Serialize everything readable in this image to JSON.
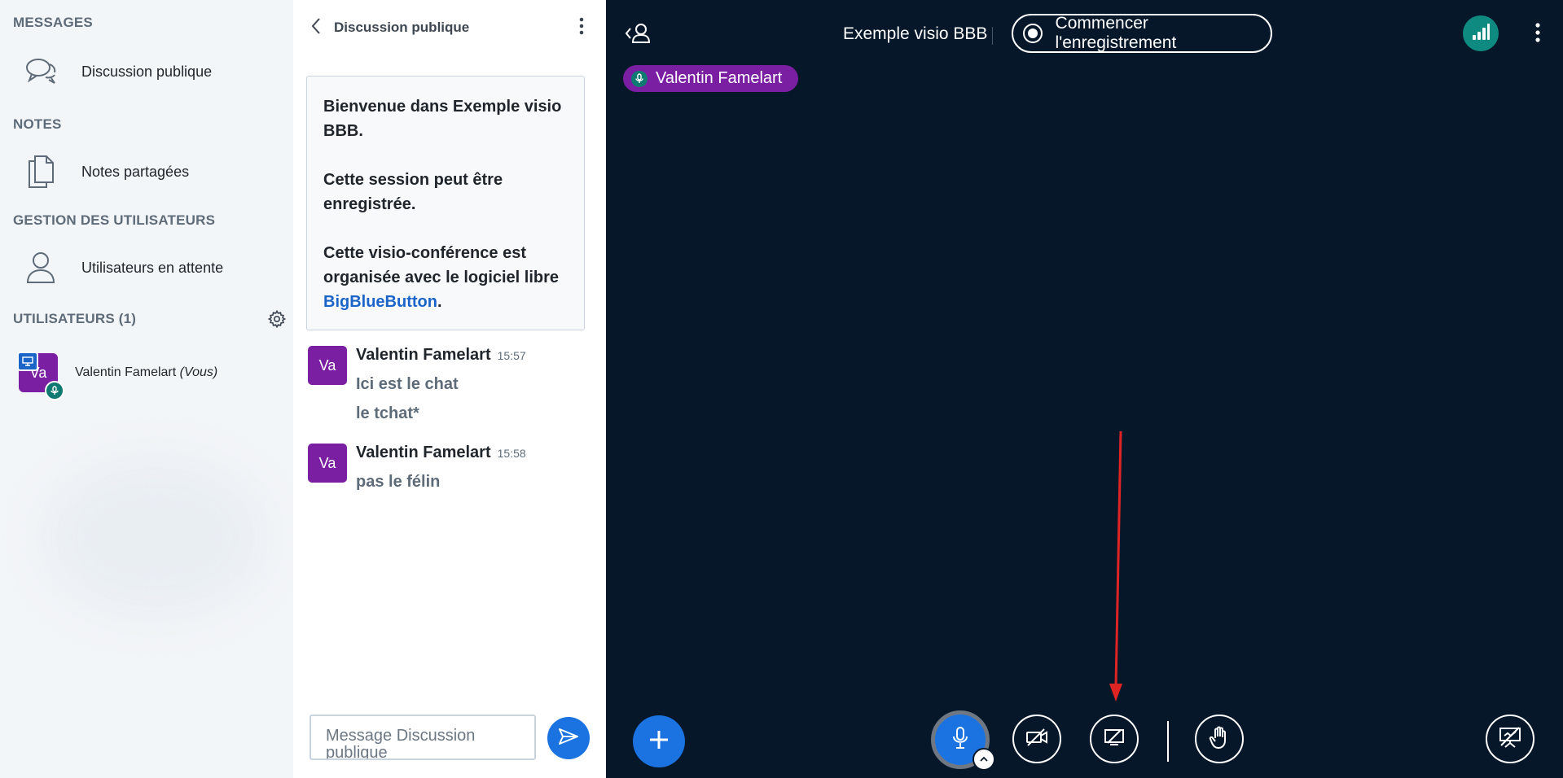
{
  "sidebar": {
    "messages_title": "MESSAGES",
    "public_chat_label": "Discussion publique",
    "notes_title": "NOTES",
    "shared_notes_label": "Notes partagées",
    "user_mgmt_title": "GESTION DES UTILISATEURS",
    "waiting_users_label": "Utilisateurs en attente",
    "users_title": "UTILISATEURS (1)",
    "user": {
      "initials": "Va",
      "name": "Valentin Famelart",
      "you_label": "(Vous)"
    }
  },
  "chat": {
    "title": "Discussion publique",
    "welcome": {
      "line1": "Bienvenue dans Exemple visio BBB.",
      "line2": "Cette session peut être enregistrée.",
      "line3_prefix": "Cette visio-conférence est organisée avec le logiciel libre ",
      "link": "BigBlueButton",
      "line3_suffix": "."
    },
    "messages": [
      {
        "initials": "Va",
        "author": "Valentin Famelart",
        "time": "15:57",
        "lines": [
          "Ici est le chat",
          "le tchat*"
        ]
      },
      {
        "initials": "Va",
        "author": "Valentin Famelart",
        "time": "15:58",
        "lines": [
          "pas le félin"
        ]
      }
    ],
    "input_placeholder": "Message Discussion publique"
  },
  "main": {
    "meeting_title": "Exemple visio BBB",
    "record_label": "Commencer l'enregistrement",
    "talking_user": "Valentin Famelart"
  },
  "colors": {
    "main_bg": "#06172a",
    "accent_blue": "#1b73e2",
    "avatar_purple": "#7b1fa2",
    "connection_green": "#0f8a80",
    "arrow_red": "#e02424"
  },
  "icons": {
    "public_chat": "chat-bubbles-icon",
    "shared_notes": "document-copy-icon",
    "waiting_users": "user-icon",
    "settings": "gear-icon",
    "back": "chevron-left-icon",
    "menu": "kebab-menu-icon",
    "send": "send-icon",
    "record": "record-icon",
    "connection": "signal-bars-icon",
    "actions": "plus-icon",
    "mic": "microphone-icon",
    "camera": "camera-off-icon",
    "screenshare": "screenshare-off-icon",
    "raise_hand": "hand-icon",
    "presentation": "presentation-off-icon"
  }
}
